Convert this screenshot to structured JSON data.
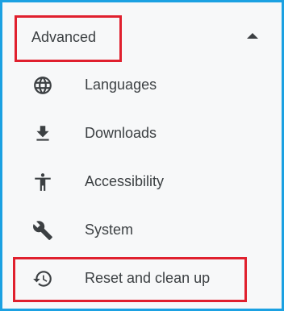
{
  "section": {
    "title": "Advanced",
    "expanded": true
  },
  "menu": {
    "items": [
      {
        "label": "Languages",
        "icon": "globe-icon"
      },
      {
        "label": "Downloads",
        "icon": "download-icon"
      },
      {
        "label": "Accessibility",
        "icon": "accessibility-icon"
      },
      {
        "label": "System",
        "icon": "wrench-icon"
      },
      {
        "label": "Reset and clean up",
        "icon": "history-icon"
      }
    ]
  },
  "highlights": {
    "color": "#e0202e",
    "targets": [
      "Advanced",
      "Reset and clean up"
    ]
  },
  "colors": {
    "text": "#3c4043",
    "background": "#f7f8f9",
    "frame_border": "#1ba1e2"
  }
}
